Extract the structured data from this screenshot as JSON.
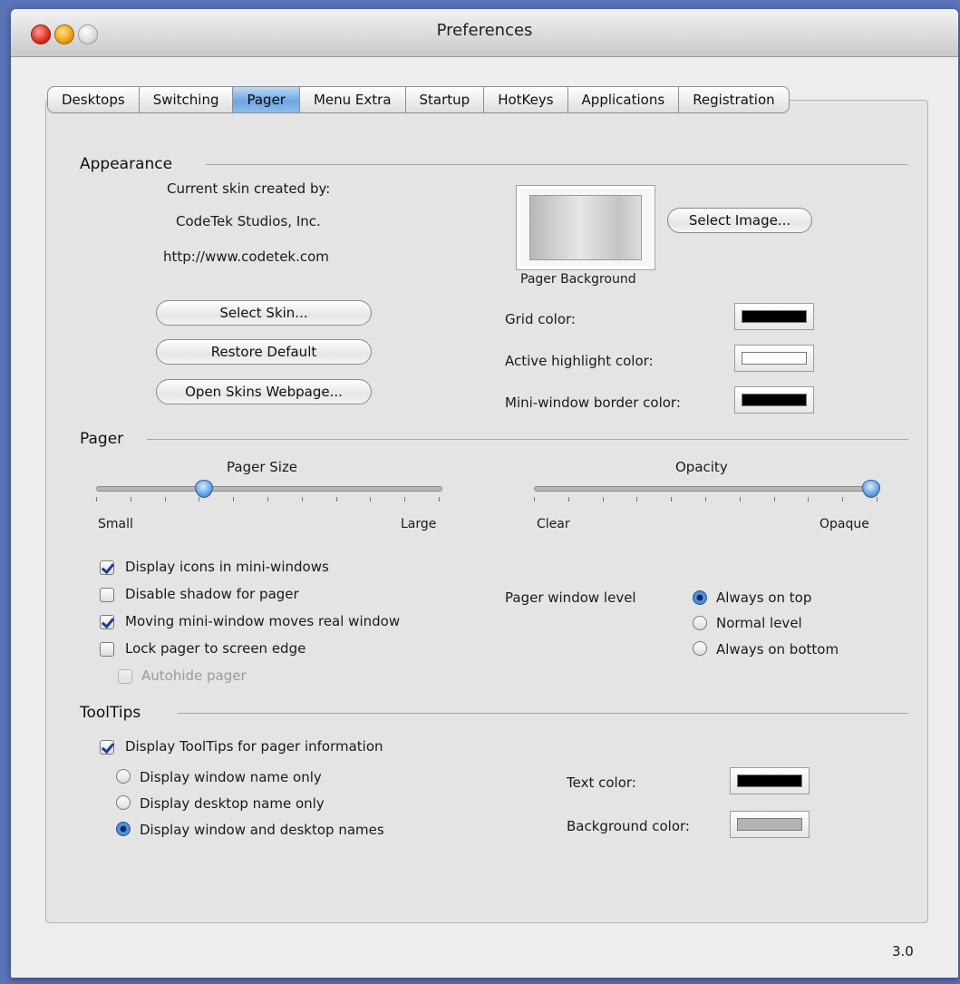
{
  "window": {
    "title": "Preferences",
    "version": "3.0"
  },
  "tabs": [
    "Desktops",
    "Switching",
    "Pager",
    "Menu Extra",
    "Startup",
    "HotKeys",
    "Applications",
    "Registration"
  ],
  "selected_tab": "Pager",
  "appearance": {
    "heading": "Appearance",
    "skin_created_by": "Current skin created by:",
    "skin_author": "CodeTek Studios, Inc.",
    "skin_url": "http://www.codetek.com",
    "select_skin": "Select Skin...",
    "restore_default": "Restore Default",
    "open_skins_webpage": "Open Skins Webpage...",
    "select_image": "Select Image...",
    "pager_background_label": "Pager Background",
    "grid_color_label": "Grid color:",
    "active_highlight_label": "Active highlight color:",
    "mini_border_label": "Mini-window border color:",
    "colors": {
      "grid": "#000000",
      "active_highlight": "#ffffff",
      "mini_border": "#000000"
    }
  },
  "pager": {
    "heading": "Pager",
    "size": {
      "title": "Pager Size",
      "min_label": "Small",
      "max_label": "Large",
      "value": 0.3
    },
    "opacity": {
      "title": "Opacity",
      "min_label": "Clear",
      "max_label": "Opaque",
      "value": 1.0
    },
    "options": [
      {
        "label": "Display icons in mini-windows",
        "checked": true,
        "enabled": true
      },
      {
        "label": "Disable shadow for pager",
        "checked": false,
        "enabled": true
      },
      {
        "label": "Moving mini-window moves real window",
        "checked": true,
        "enabled": true
      },
      {
        "label": "Lock pager to screen edge",
        "checked": false,
        "enabled": true
      },
      {
        "label": "Autohide pager",
        "checked": false,
        "enabled": false
      }
    ],
    "window_level": {
      "label": "Pager window level",
      "options": [
        "Always on top",
        "Normal level",
        "Always on bottom"
      ],
      "selected": "Always on top"
    }
  },
  "tooltips": {
    "heading": "ToolTips",
    "display_tooltips": {
      "label": "Display ToolTips for pager information",
      "checked": true
    },
    "mode_options": [
      "Display window name only",
      "Display desktop name only",
      "Display window and desktop names"
    ],
    "selected_mode": "Display window and desktop names",
    "text_color_label": "Text color:",
    "background_color_label": "Background color:",
    "colors": {
      "text": "#000000",
      "background": "#b4b4b4"
    }
  }
}
